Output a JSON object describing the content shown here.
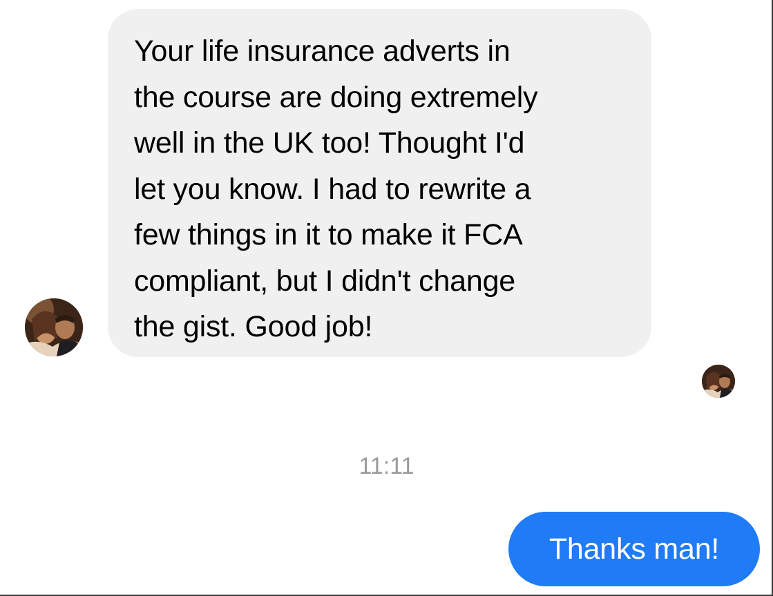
{
  "conversation": {
    "incoming_message": {
      "text": "Your life insurance adverts in\nthe course are doing extremely\nwell in the UK too! Thought I'd\nlet you know. I had to rewrite a\nfew things in it to make it FCA\ncompliant, but I didn't change\nthe gist. Good job!",
      "sender_avatar_icon": "profile-photo-icon"
    },
    "read_receipt_avatar_icon": "profile-photo-icon",
    "timestamp": "11:11",
    "outgoing_message": {
      "text": "Thanks man!"
    }
  },
  "colors": {
    "incoming_bubble": "#f0f0f0",
    "outgoing_bubble": "#1f7bf6",
    "timestamp_text": "#9a9a9a",
    "background": "#ffffff"
  }
}
